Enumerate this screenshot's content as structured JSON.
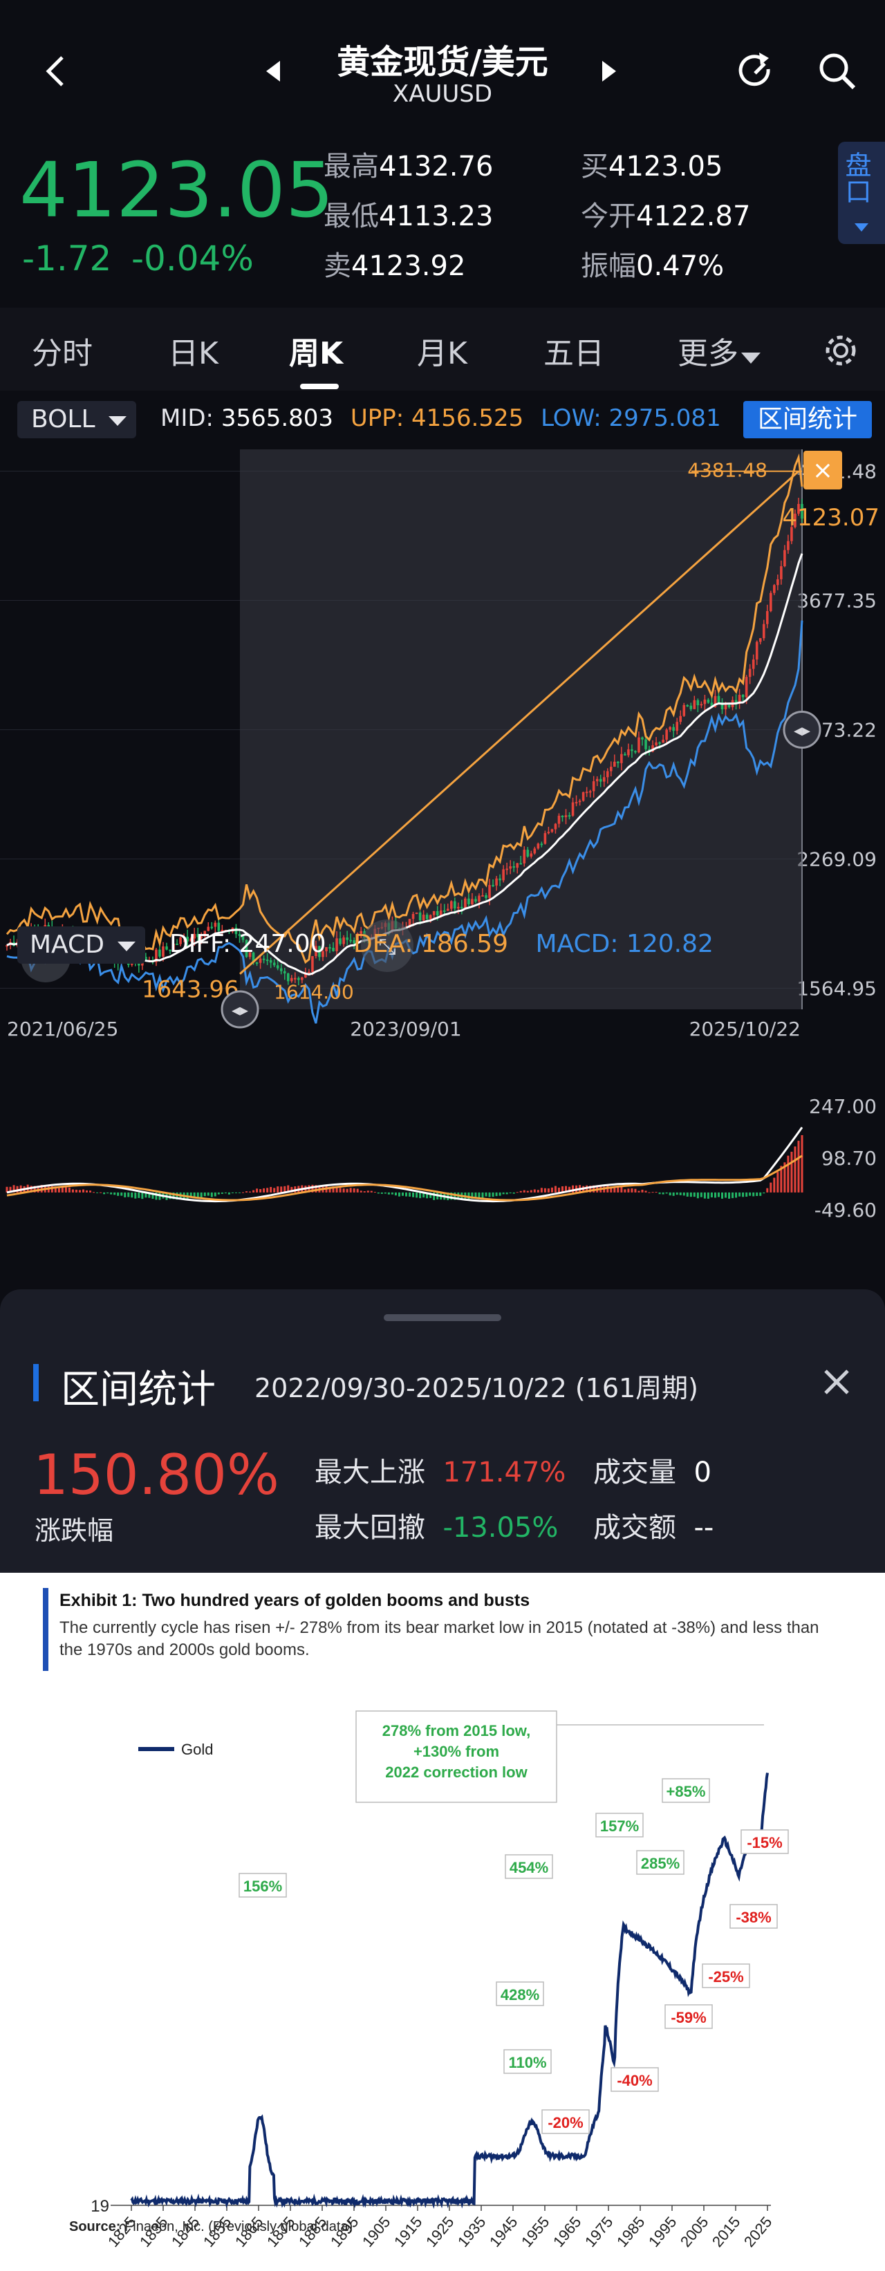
{
  "header": {
    "title": "黄金现货/美元",
    "symbol": "XAUUSD",
    "side_tab": "盘口"
  },
  "quote": {
    "price": "4123.05",
    "change": "-1.72",
    "change_pct": "-0.04%",
    "high_label": "最高",
    "high": "4132.76",
    "low_label": "最低",
    "low": "4113.23",
    "sell_label": "卖",
    "sell": "4123.92",
    "buy_label": "买",
    "buy": "4123.05",
    "open_label": "今开",
    "open": "4122.87",
    "amp_label": "振幅",
    "amp": "0.47%"
  },
  "tabs": [
    "分时",
    "日K",
    "周K",
    "月K",
    "五日",
    "更多"
  ],
  "active_tab": "周K",
  "boll": {
    "name": "BOLL",
    "mid_label": "MID:",
    "mid": "3565.803",
    "upp_label": "UPP:",
    "upp": "4156.525",
    "low_label": "LOW:",
    "low": "2975.081",
    "range_button": "区间统计"
  },
  "price_axis": [
    "4381.48",
    "3677.35",
    "2973.22",
    "2269.09",
    "1564.95"
  ],
  "markers": {
    "high_marker": "4381.48",
    "last_marker": "4123.07",
    "low_marker": "1614.00",
    "start_marker": "1643.96"
  },
  "date_axis": [
    "2021/06/25",
    "2023/09/01",
    "2025/10/22"
  ],
  "macd": {
    "name": "MACD",
    "diff_label": "DIFF:",
    "diff": "247.00",
    "dea_label": "DEA:",
    "dea": "186.59",
    "macd_label": "MACD:",
    "macd": "120.82",
    "axis": [
      "247.00",
      "98.70",
      "-49.60"
    ]
  },
  "colors": {
    "up": "#e5433b",
    "down": "#22b565",
    "boll_mid": "#ffffff",
    "boll_upp": "#f5a340",
    "boll_low": "#3a8ee8",
    "accent": "#1e6fe0"
  },
  "range_stats": {
    "title": "区间统计",
    "range": "2022/09/30-2025/10/22 (161周期)",
    "change_pct": "150.80%",
    "change_label": "涨跌幅",
    "max_rise_label": "最大上涨",
    "max_rise": "171.47%",
    "max_drawdown_label": "最大回撤",
    "max_drawdown": "-13.05%",
    "volume_label": "成交量",
    "volume": "0",
    "turnover_label": "成交额",
    "turnover": "--"
  },
  "report": {
    "exhibit_title": "Exhibit 1: Two hundred years of golden booms and busts",
    "exhibit_text": "The currently cycle has risen +/- 278% from its bear market low in 2015 (notated at -38%) and less than the 1970s and 2000s gold booms.",
    "legend": "Gold",
    "callout_box": "278%  from 2015 low, +130% from 2022 correction low",
    "source_label": "Source:",
    "source_text": "Finaeon, Inc. (Previously global data)",
    "axis_min": "19"
  },
  "chart_data": {
    "type": "line",
    "title": "",
    "xlabel": "",
    "ylabel": "",
    "x": [
      "1825",
      "1835",
      "1845",
      "1855",
      "1865",
      "1875",
      "1885",
      "1895",
      "1905",
      "1915",
      "1925",
      "1935",
      "1945",
      "1955",
      "1965",
      "1975",
      "1985",
      "1995",
      "2005",
      "2015",
      "2025"
    ],
    "series": [
      {
        "name": "Gold",
        "values": []
      }
    ],
    "annotations": [
      {
        "text": "156%",
        "year": 1866,
        "color": "#2eaa4a"
      },
      {
        "text": "110%",
        "year": 1952,
        "color": "#2eaa4a"
      },
      {
        "text": "-20%",
        "year": 1965,
        "color": "#e0201e"
      },
      {
        "text": "428%",
        "year": 1974,
        "color": "#2eaa4a"
      },
      {
        "text": "-40%",
        "year": 1977,
        "color": "#e0201e"
      },
      {
        "text": "454%",
        "year": 1980,
        "color": "#2eaa4a"
      },
      {
        "text": "-59%",
        "year": 2000,
        "color": "#e0201e"
      },
      {
        "text": "157%",
        "year": 2008,
        "color": "#2eaa4a"
      },
      {
        "text": "-25%",
        "year": 2009,
        "color": "#e0201e"
      },
      {
        "text": "285%",
        "year": 2011,
        "color": "#2eaa4a"
      },
      {
        "text": "-38%",
        "year": 2015,
        "color": "#e0201e"
      },
      {
        "text": "+85%",
        "year": 2020,
        "color": "#2eaa4a"
      },
      {
        "text": "-15%",
        "year": 2022,
        "color": "#e0201e"
      }
    ]
  }
}
